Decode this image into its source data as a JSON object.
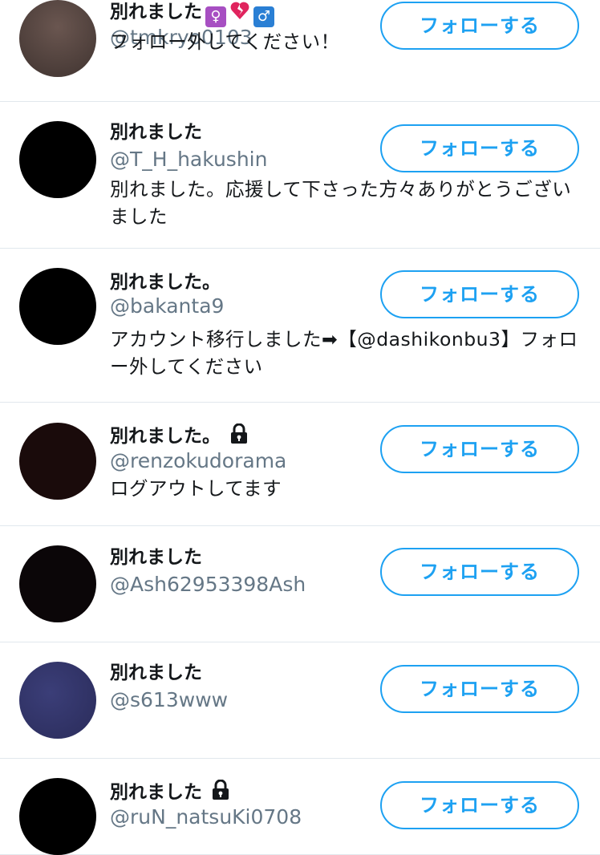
{
  "follow_button_label": "フォローする",
  "colors": {
    "accent": "#1da1f2",
    "handle": "#657786",
    "divider": "#e1e8ed"
  },
  "users": [
    {
      "name": "別れました",
      "emoji_icons": [
        "womens-room-icon",
        "broken-heart-icon",
        "mens-room-icon"
      ],
      "handle": "@tmkryo0103",
      "bio": "フォロー外してください！",
      "avatar_color": "#4a3c38",
      "locked": false
    },
    {
      "name": "別れました",
      "handle": "@T_H_hakushin",
      "bio": "別れました。応援して下さった方々ありがとうございました",
      "avatar_color": "#000000",
      "locked": false
    },
    {
      "name": "別れました。",
      "handle": "@bakanta9",
      "bio": "アカウント移行しました➡【@dashikonbu3】フォロー外してください",
      "avatar_color": "#000000",
      "locked": false
    },
    {
      "name": "別れました。",
      "handle": "@renzokudorama",
      "bio": "ログアウトしてます",
      "avatar_color": "#1a0b0b",
      "locked": true
    },
    {
      "name": "別れました",
      "handle": "@Ash62953398Ash",
      "bio": "",
      "avatar_color": "#0b0608",
      "locked": false
    },
    {
      "name": "別れました",
      "handle": "@s613www",
      "bio": "",
      "avatar_color": "#2f3163",
      "locked": false
    },
    {
      "name": "別れました",
      "handle": "@ruN_natsuKi0708",
      "bio": "",
      "avatar_color": "#000000",
      "locked": true
    }
  ]
}
